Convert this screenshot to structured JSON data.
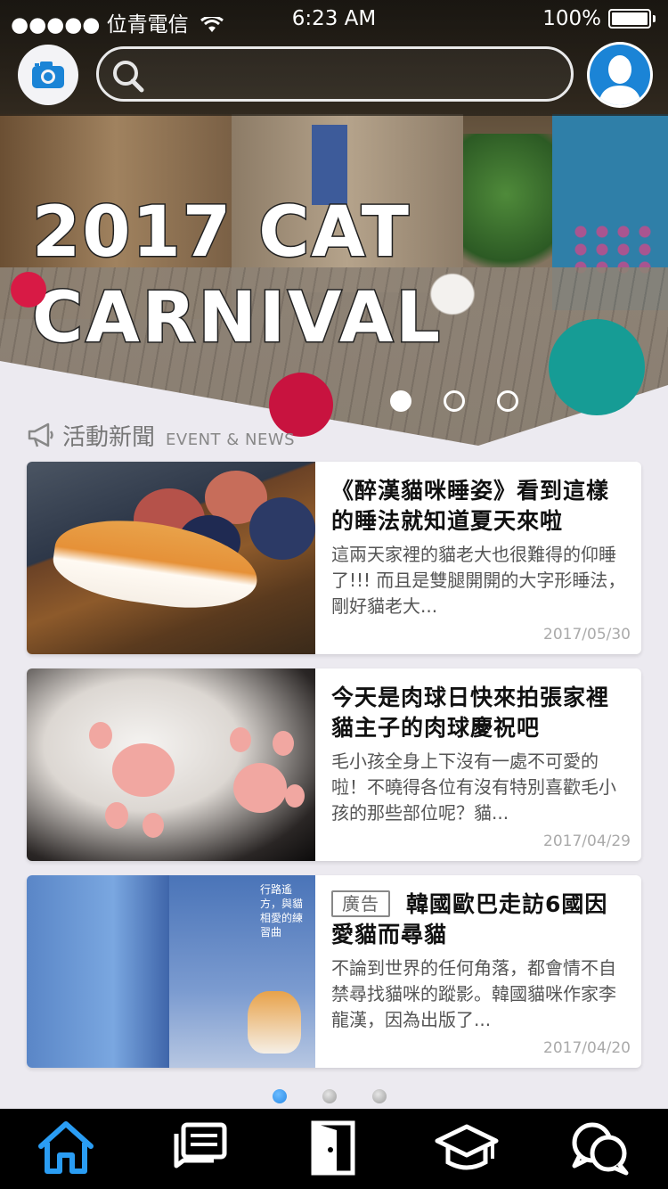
{
  "status_bar": {
    "carrier": "●●●●● 位青電信",
    "time": "6:23 AM",
    "battery": "100%"
  },
  "header": {
    "search_placeholder": ""
  },
  "banner": {
    "line1": "2017 CAT",
    "line2": "CARNIVAL",
    "carousel": {
      "count": 3,
      "active_index": 0
    }
  },
  "section": {
    "title_zh": "活動新聞",
    "title_en": "EVENT & NEWS"
  },
  "news": [
    {
      "title": "《醉漢貓咪睡姿》看到這樣的睡法就知道夏天來啦",
      "desc": "這兩天家裡的貓老大也很難得的仰睡了!!! 而且是雙腿開開的大字形睡法，剛好貓老大...",
      "date": "2017/05/30"
    },
    {
      "title": "今天是肉球日快來拍張家裡貓主子的肉球慶祝吧",
      "desc": "毛小孩全身上下沒有一處不可愛的啦！不曉得各位有沒有特別喜歡毛小孩的那些部位呢？貓...",
      "date": "2017/04/29"
    },
    {
      "badge": "廣告",
      "title": "韓國歐巴走訪6國因愛貓而尋貓",
      "desc": "不論到世界的任何角落，都會情不自禁尋找貓咪的蹤影。韓國貓咪作家李龍漢，因為出版了...",
      "date": "2017/04/20",
      "image_text": "行路遙方，與貓相愛的練習曲"
    }
  ],
  "list_pager": {
    "count": 3,
    "active_index": 0
  },
  "tab_bar": {
    "icons": [
      "home-icon",
      "news-icon",
      "door-icon",
      "graduation-cap-icon",
      "chat-icon"
    ],
    "active_index": 0
  },
  "colors": {
    "accent_blue": "#1b84d6",
    "banner_red": "#d81a45",
    "banner_teal": "#169c95",
    "tab_active": "#2a9df4",
    "tab_inactive": "#ffffff"
  }
}
